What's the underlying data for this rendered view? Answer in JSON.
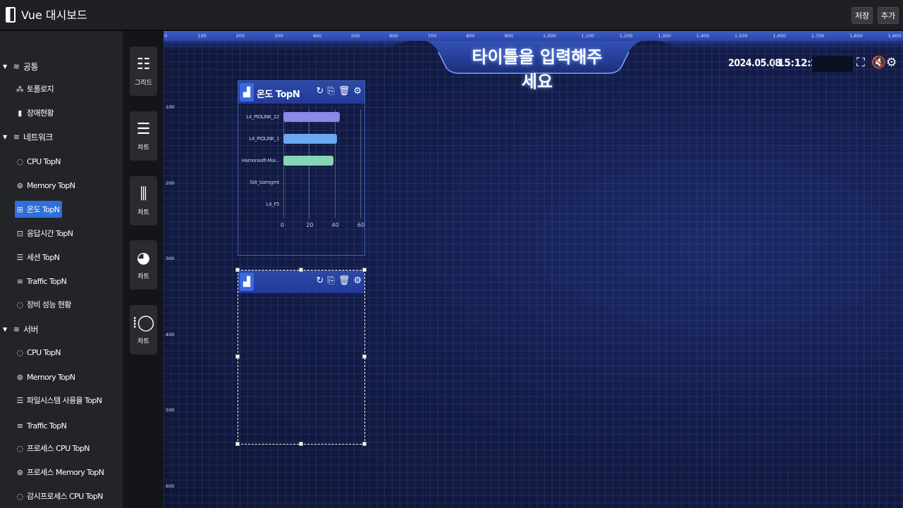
{
  "app": {
    "title": "Vue 대시보드",
    "save_label": "저장",
    "add_label": "추가"
  },
  "sidebar": {
    "groups": [
      {
        "label": "공통",
        "items": [
          {
            "label": "토폴로지",
            "icon": "topology-icon"
          },
          {
            "label": "장애현황",
            "icon": "alert-icon"
          }
        ]
      },
      {
        "label": "네트워크",
        "items": [
          {
            "label": "CPU TopN",
            "icon": "gauge-icon"
          },
          {
            "label": "Memory TopN",
            "icon": "memory-icon"
          },
          {
            "label": "온도 TopN",
            "icon": "thermometer-icon",
            "selected": true
          },
          {
            "label": "응답시간 TopN",
            "icon": "clock-icon"
          },
          {
            "label": "세션 TopN",
            "icon": "list-icon"
          },
          {
            "label": "Traffic TopN",
            "icon": "bars-icon"
          },
          {
            "label": "장비 성능 현황",
            "icon": "gauge-icon"
          }
        ]
      },
      {
        "label": "서버",
        "items": [
          {
            "label": "CPU TopN",
            "icon": "gauge-icon"
          },
          {
            "label": "Memory TopN",
            "icon": "memory-icon"
          },
          {
            "label": "파일시스템 사용율 TopN",
            "icon": "list-icon"
          },
          {
            "label": "Traffic TopN",
            "icon": "bars-icon"
          },
          {
            "label": "프로세스 CPU TopN",
            "icon": "gauge-icon"
          },
          {
            "label": "프로세스 Memory TopN",
            "icon": "memory-icon"
          },
          {
            "label": "감시프로세스 CPU TopN",
            "icon": "gauge-icon"
          }
        ]
      }
    ]
  },
  "palette": [
    {
      "label": "그리드",
      "icon": "grid-icon"
    },
    {
      "label": "차트",
      "icon": "hbar-chart-icon"
    },
    {
      "label": "차트",
      "icon": "vbar-chart-icon"
    },
    {
      "label": "차트",
      "icon": "pie-chart-icon"
    },
    {
      "label": "차트",
      "icon": "gauge-chart-icon"
    }
  ],
  "canvas": {
    "title": "타이틀을 입력해주세요",
    "date": "2024.05.08",
    "separator": "|",
    "time": "15:12:28",
    "ruler_x": [
      "0",
      "100",
      "200",
      "300",
      "400",
      "500",
      "600",
      "700",
      "800",
      "900",
      "1,000",
      "1,100",
      "1,200",
      "1,300",
      "1,400",
      "1,500",
      "1,600",
      "1,700",
      "1,800",
      "1,900"
    ],
    "ruler_y": [
      "100",
      "200",
      "300",
      "400",
      "500",
      "600"
    ]
  },
  "widget1": {
    "title": "온도 TopN"
  },
  "widget2": {
    "title": ""
  },
  "chart_data": {
    "type": "bar",
    "orientation": "horizontal",
    "categories": [
      "L4_PIOLINK_22",
      "L4_PIOLINK_1",
      "Hamonsoft-Mai...",
      "SW_bizmgmt",
      "L4_F5"
    ],
    "values": [
      44,
      42,
      39,
      0,
      0
    ],
    "colors": [
      "#8a8ae6",
      "#6aa8f0",
      "#86d6b6",
      "#8a8ae6",
      "#8a8ae6"
    ],
    "xticks": [
      "0",
      "20",
      "40",
      "60"
    ],
    "xlim": [
      0,
      60
    ],
    "grid": true
  }
}
